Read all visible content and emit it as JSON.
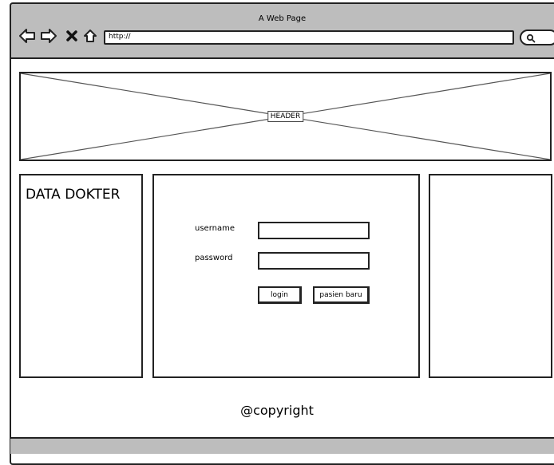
{
  "browser": {
    "title": "A Web Page",
    "url": "http://",
    "nav_icons": [
      "back-icon",
      "forward-icon",
      "close-icon",
      "home-icon"
    ],
    "search_icon": "search-icon"
  },
  "header": {
    "label": "HEADER"
  },
  "sidebar_left": {
    "title": "DATA DOKTER"
  },
  "login_form": {
    "username_label": "username",
    "username_value": "",
    "password_label": "password",
    "password_value": "",
    "login_button": "login",
    "new_patient_button": "pasien baru"
  },
  "footer": {
    "copyright": "@copyright"
  },
  "colors": {
    "chrome": "#bdbdbd",
    "border": "#222222",
    "background": "#ffffff"
  }
}
